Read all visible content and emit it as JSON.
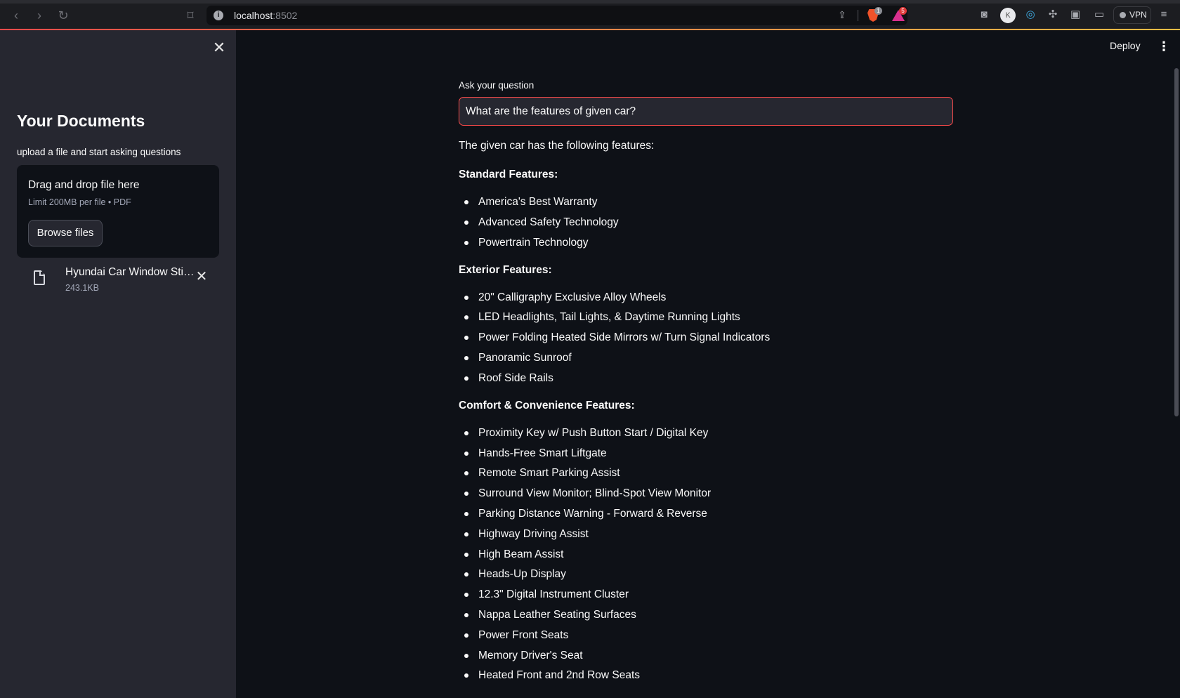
{
  "browser": {
    "url_host": "localhost",
    "url_port": ":8502",
    "brave_badge": "1",
    "rewards_badge": "5",
    "vpn_label": "VPN"
  },
  "sidebar": {
    "title": "Your Documents",
    "caption": "upload a file and start asking questions",
    "dropzone": {
      "title": "Drag and drop file here",
      "limit": "Limit 200MB per file • PDF",
      "browse_label": "Browse files"
    },
    "file": {
      "name": "Hyundai Car Window Stic…",
      "size": "243.1KB"
    }
  },
  "header": {
    "deploy_label": "Deploy"
  },
  "question": {
    "label": "Ask your question",
    "value": "What are the features of given car?"
  },
  "answer": {
    "intro": "The given car has the following features:",
    "sections": [
      {
        "heading": "Standard Features:",
        "items": [
          "America's Best Warranty",
          "Advanced Safety Technology",
          "Powertrain Technology"
        ]
      },
      {
        "heading": "Exterior Features:",
        "items": [
          "20\" Calligraphy Exclusive Alloy Wheels",
          "LED Headlights, Tail Lights, & Daytime Running Lights",
          "Power Folding Heated Side Mirrors w/ Turn Signal Indicators",
          "Panoramic Sunroof",
          "Roof Side Rails"
        ]
      },
      {
        "heading": "Comfort & Convenience Features:",
        "items": [
          "Proximity Key w/ Push Button Start / Digital Key",
          "Hands-Free Smart Liftgate",
          "Remote Smart Parking Assist",
          "Surround View Monitor; Blind-Spot View Monitor",
          "Parking Distance Warning - Forward & Reverse",
          "Highway Driving Assist",
          "High Beam Assist",
          "Heads-Up Display",
          "12.3\" Digital Instrument Cluster",
          "Nappa Leather Seating Surfaces",
          "Power Front Seats",
          "Memory Driver's Seat",
          "Heated Front and 2nd Row Seats"
        ]
      }
    ]
  }
}
